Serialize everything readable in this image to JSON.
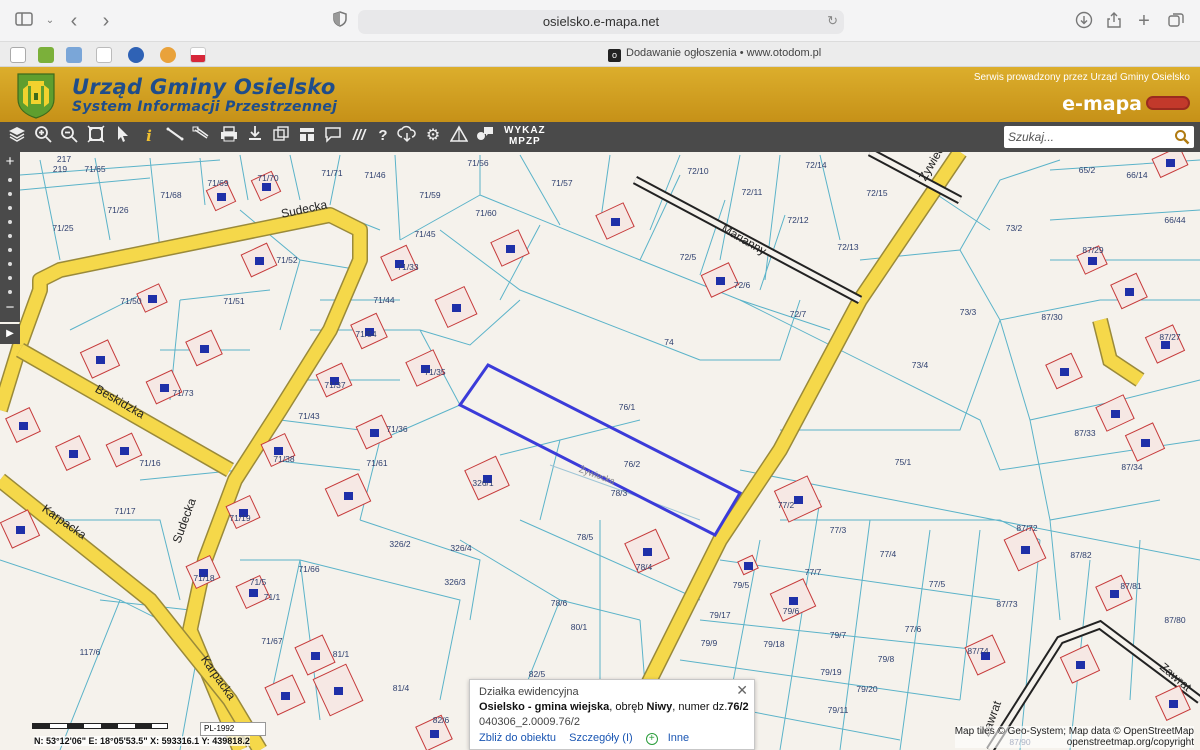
{
  "browser": {
    "url": "osielsko.e-mapa.net",
    "tab2_title": "Dodawanie ogłoszenia • www.otodom.pl"
  },
  "header": {
    "title": "Urząd Gminy Osielsko",
    "subtitle": "System Informacji Przestrzennej",
    "service_note": "Serwis prowadzony przez Urząd Gminy Osielsko",
    "brand": "e-mapa"
  },
  "toolbar": {
    "wykaz_line1": "WYKAZ",
    "wykaz_line2": "MPZP",
    "search_placeholder": "Szukaj..."
  },
  "map": {
    "parcel_labels": [
      "217",
      "219",
      "71/65",
      "71/69",
      "71/70",
      "71/71",
      "71/46",
      "71/56",
      "71/57",
      "72/10",
      "72/11",
      "72/14",
      "72/15",
      "71/26",
      "71/68",
      "71/59",
      "71/60",
      "72/12",
      "72/13",
      "73/2",
      "65/2",
      "66/14",
      "66/44",
      "71/25",
      "71/52",
      "71/45",
      "71/33",
      "72/5",
      "72/6",
      "87/29",
      "71/50",
      "71/51",
      "71/44",
      "72/7",
      "73/3",
      "87/30",
      "71/54",
      "74",
      "87/27",
      "71/73",
      "71/37",
      "71/35",
      "73/4",
      "76/1",
      "87/33",
      "71/43",
      "71/36",
      "87/34",
      "71/16",
      "71/38",
      "71/61",
      "76/2",
      "75/1",
      "326/1",
      "78/3",
      "71/17",
      "71/19",
      "77/2",
      "77/3",
      "326/2",
      "326/4",
      "78/5",
      "87/72",
      "87/82",
      "71/18",
      "71/5",
      "71/66",
      "326/3",
      "78/4",
      "77/4",
      "77/7",
      "87/81",
      "71/1",
      "79/5",
      "77/5",
      "87/73",
      "87/80",
      "78/6",
      "79/6",
      "117/6",
      "79/17",
      "77/6",
      "71/67",
      "81/1",
      "80/1",
      "79/7",
      "87/74",
      "79/9",
      "79/18",
      "79/8",
      "82/5",
      "79/19",
      "81/4",
      "79/20",
      "82/6",
      "79/11",
      "87/90"
    ],
    "street_labels": [
      "Sudecka",
      "Marianny",
      "Żywiecka",
      "Beskidzka",
      "Sudecka",
      "Karpacka",
      "Karpacka",
      "Żywiecka",
      "Zawrat",
      "Zawrat"
    ]
  },
  "popup": {
    "heading": "Działka ewidencyjna",
    "main_bold": "Osielsko - gmina wiejska",
    "main_mid": ", obręb ",
    "main_obreb": "Niwy",
    "main_tail": ", numer dz.",
    "main_num": "76/2",
    "parcel_id": "040306_2.0009.76/2",
    "link_zoom": "Zbliż do obiektu",
    "link_details": "Szczegóły (I)",
    "link_other": "Inne"
  },
  "status": {
    "crs": "PL-1992",
    "coords_text": "N: 53°12'06\"  E: 18°05'53.5\"  X: 593316.1  Y: 439818.2",
    "attribution_1": "Map tiles © Geo-System; Map data © OpenStreetMap",
    "attribution_2": "openstreetmap.org/copyright"
  },
  "colors": {
    "header_gold": "#d4a424",
    "header_text": "#1f4d8a",
    "road_yellow": "#f5d84a",
    "parcel_line": "#5bb3c9",
    "building_line": "#c63a3a",
    "selection_outline": "#3b3bd9"
  }
}
